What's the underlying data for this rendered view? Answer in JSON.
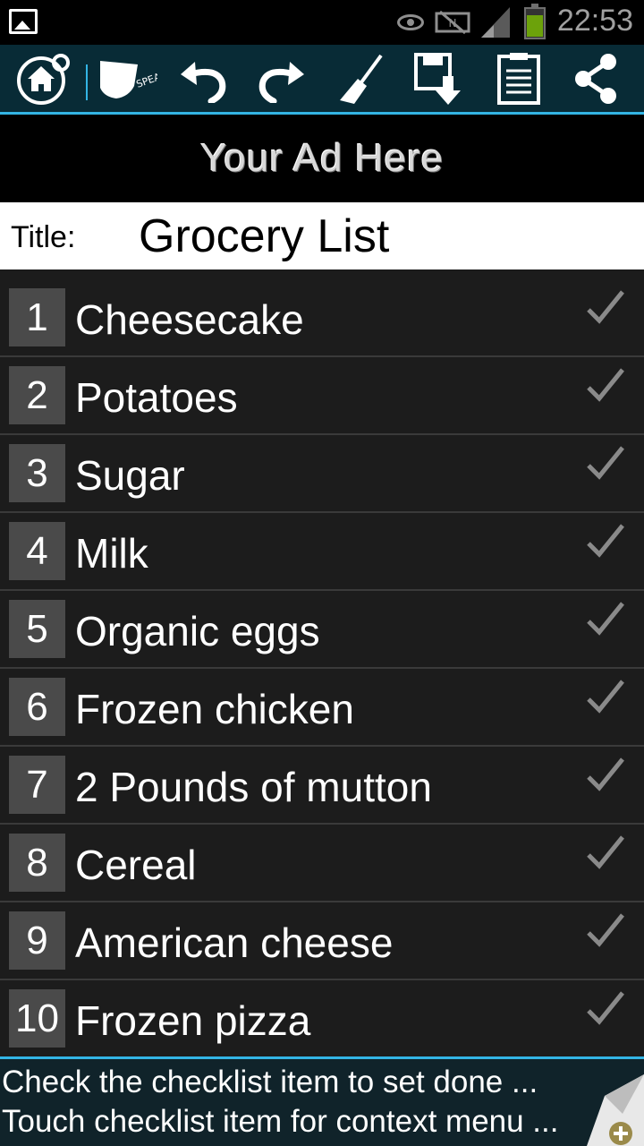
{
  "status_bar": {
    "time": "22:53"
  },
  "toolbar": {
    "icons": [
      "home-icon",
      "speak-icon",
      "undo-icon",
      "redo-icon",
      "clear-icon",
      "save-icon",
      "clipboard-icon",
      "share-icon"
    ],
    "speak_label": "SPEAK"
  },
  "ad": {
    "text": "Your Ad Here"
  },
  "title": {
    "label": "Title:",
    "value": "Grocery List"
  },
  "items": [
    {
      "number": "1",
      "text": "Cheesecake"
    },
    {
      "number": "2",
      "text": "Potatoes"
    },
    {
      "number": "3",
      "text": "Sugar"
    },
    {
      "number": "4",
      "text": "Milk"
    },
    {
      "number": "5",
      "text": "Organic eggs"
    },
    {
      "number": "6",
      "text": "Frozen chicken"
    },
    {
      "number": "7",
      "text": "2 Pounds of mutton"
    },
    {
      "number": "8",
      "text": "Cereal"
    },
    {
      "number": "9",
      "text": "American cheese"
    },
    {
      "number": "10",
      "text": "Frozen pizza"
    }
  ],
  "footer": {
    "line1": "Check the checklist item to set done ...",
    "line2": "Touch checklist item for context menu ..."
  },
  "colors": {
    "accent": "#33b5e5",
    "toolbar_bg": "#082b36",
    "row_bg": "#1c1c1c",
    "number_bg": "#4a4a4a",
    "battery": "#6ca20b"
  }
}
